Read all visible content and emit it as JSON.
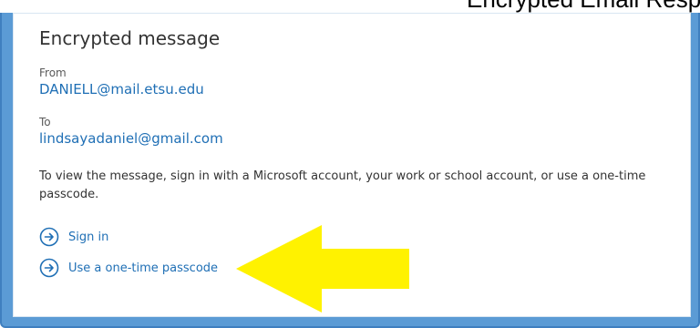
{
  "header": {
    "fragment": "Encrypted Email Response"
  },
  "message": {
    "title": "Encrypted message",
    "from_label": "From",
    "from_address": "DANIELL@mail.etsu.edu",
    "to_label": "To",
    "to_address": "lindsayadaniel@gmail.com",
    "instructions": "To view the message, sign in with a Microsoft account, your work or school account, or use a one-time passcode."
  },
  "actions": {
    "sign_in": "Sign in",
    "one_time_passcode": "Use a one-time passcode"
  },
  "icons": {
    "action": "arrow-right-circle-icon",
    "annotation": "yellow-arrow-icon"
  },
  "colors": {
    "frame": "#5b9bd5",
    "link": "#1f6fb5",
    "annotation_arrow": "#fff200"
  }
}
